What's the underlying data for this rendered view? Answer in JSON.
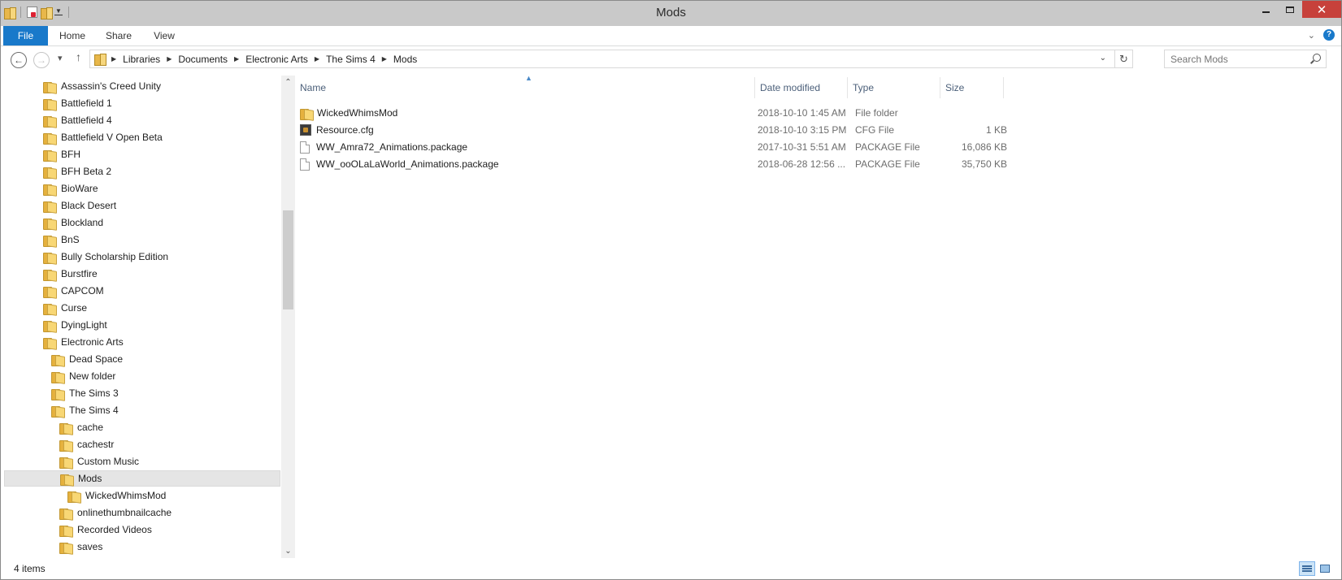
{
  "window": {
    "title": "Mods"
  },
  "ribbon": {
    "tabs": [
      {
        "label": "File",
        "active": true
      },
      {
        "label": "Home"
      },
      {
        "label": "Share"
      },
      {
        "label": "View"
      }
    ]
  },
  "address": {
    "breadcrumbs": [
      "Libraries",
      "Documents",
      "Electronic Arts",
      "The Sims 4",
      "Mods"
    ]
  },
  "search": {
    "placeholder": "Search Mods"
  },
  "nav_tree": [
    {
      "label": "Assassin's Creed Unity",
      "level": 0
    },
    {
      "label": "Battlefield 1",
      "level": 0
    },
    {
      "label": "Battlefield 4",
      "level": 0
    },
    {
      "label": "Battlefield V Open Beta",
      "level": 0
    },
    {
      "label": "BFH",
      "level": 0
    },
    {
      "label": "BFH Beta 2",
      "level": 0
    },
    {
      "label": "BioWare",
      "level": 0
    },
    {
      "label": "Black Desert",
      "level": 0
    },
    {
      "label": "Blockland",
      "level": 0
    },
    {
      "label": "BnS",
      "level": 0
    },
    {
      "label": "Bully Scholarship Edition",
      "level": 0
    },
    {
      "label": "Burstfire",
      "level": 0
    },
    {
      "label": "CAPCOM",
      "level": 0
    },
    {
      "label": "Curse",
      "level": 0
    },
    {
      "label": "DyingLight",
      "level": 0
    },
    {
      "label": "Electronic Arts",
      "level": 0
    },
    {
      "label": "Dead Space",
      "level": 1
    },
    {
      "label": "New folder",
      "level": 1
    },
    {
      "label": "The Sims 3",
      "level": 1
    },
    {
      "label": "The Sims 4",
      "level": 1
    },
    {
      "label": "cache",
      "level": 2
    },
    {
      "label": "cachestr",
      "level": 2
    },
    {
      "label": "Custom Music",
      "level": 2
    },
    {
      "label": "Mods",
      "level": 2,
      "selected": true
    },
    {
      "label": "WickedWhimsMod",
      "level": 3
    },
    {
      "label": "onlinethumbnailcache",
      "level": 2
    },
    {
      "label": "Recorded Videos",
      "level": 2
    },
    {
      "label": "saves",
      "level": 2
    }
  ],
  "columns": {
    "name": "Name",
    "date": "Date modified",
    "type": "Type",
    "size": "Size"
  },
  "files": [
    {
      "name": "WickedWhimsMod",
      "date": "2018-10-10 1:45 AM",
      "type": "File folder",
      "size": "",
      "icon": "folder-icon"
    },
    {
      "name": "Resource.cfg",
      "date": "2018-10-10 3:15 PM",
      "type": "CFG File",
      "size": "1 KB",
      "icon": "cfg-file-icon"
    },
    {
      "name": "WW_Amra72_Animations.package",
      "date": "2017-10-31 5:51 AM",
      "type": "PACKAGE File",
      "size": "16,086 KB",
      "icon": "file-icon"
    },
    {
      "name": "WW_ooOLaLaWorld_Animations.package",
      "date": "2018-06-28 12:56 ...",
      "type": "PACKAGE File",
      "size": "35,750 KB",
      "icon": "file-icon"
    }
  ],
  "status": {
    "item_count": "4 items"
  },
  "colors": {
    "file_tab": "#1979ca",
    "selection": "#e5e5e5",
    "close_button": "#c7413b",
    "header_text": "#4c607a"
  }
}
